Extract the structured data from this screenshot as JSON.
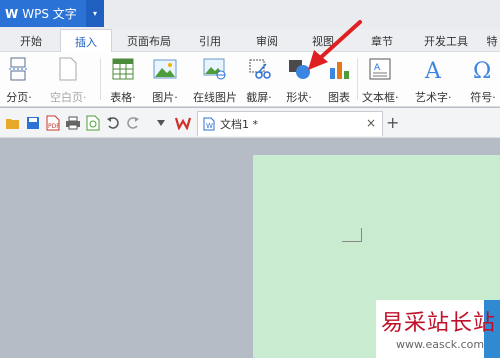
{
  "app": {
    "logo": "W",
    "title": "WPS 文字",
    "menu_arrow": "▾"
  },
  "tabs": [
    {
      "label": "开始"
    },
    {
      "label": "插入",
      "active": true
    },
    {
      "label": "页面布局"
    },
    {
      "label": "引用"
    },
    {
      "label": "审阅"
    },
    {
      "label": "视图"
    },
    {
      "label": "章节"
    },
    {
      "label": "开发工具"
    },
    {
      "label": "特"
    }
  ],
  "ribbon": {
    "pagination": "分页·",
    "blank_page": "空白页·",
    "table": "表格·",
    "picture": "图片·",
    "online_picture": "在线图片",
    "screenshot": "截屏·",
    "shape": "形状·",
    "chart": "图表",
    "textbox": "文本框·",
    "wordart": "艺术字·",
    "symbol": "符号·"
  },
  "document": {
    "tab_label": "文档1 *",
    "close": "×",
    "new_tab": "+"
  },
  "watermark": {
    "site": "易采站长站",
    "url": "www.easck.com"
  },
  "colors": {
    "brand": "#2a72d6",
    "page": "#c9ecd0",
    "arrow": "#e02020"
  }
}
